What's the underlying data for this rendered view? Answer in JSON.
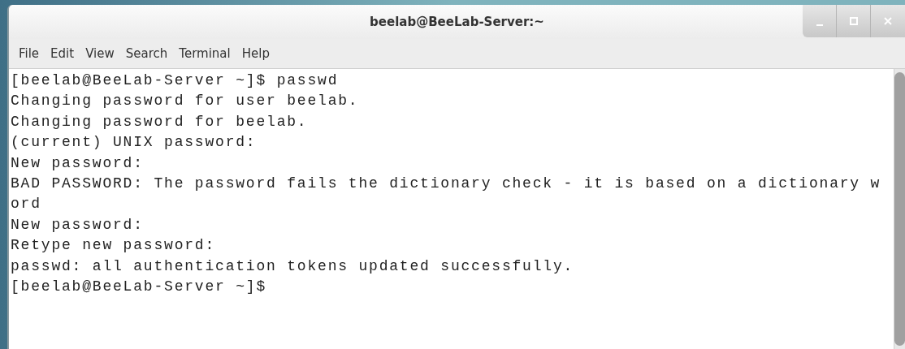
{
  "window": {
    "title": "beelab@BeeLab-Server:~"
  },
  "menu": [
    "File",
    "Edit",
    "View",
    "Search",
    "Terminal",
    "Help"
  ],
  "terminal": {
    "lines": [
      "[beelab@BeeLab-Server ~]$ passwd",
      "Changing password for user beelab.",
      "Changing password for beelab.",
      "(current) UNIX password:",
      "New password:",
      "BAD PASSWORD: The password fails the dictionary check - it is based on a dictionary w",
      "ord",
      "New password:",
      "Retype new password:",
      "passwd: all authentication tokens updated successfully.",
      "[beelab@BeeLab-Server ~]$"
    ]
  }
}
